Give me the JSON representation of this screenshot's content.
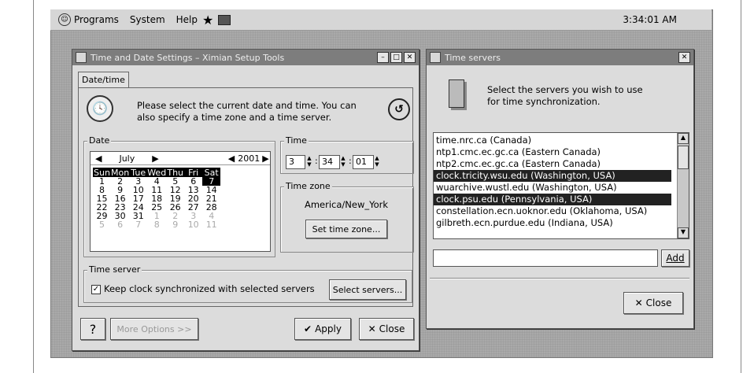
{
  "panel": {
    "programs": "Programs",
    "system": "System",
    "help": "Help",
    "clock": "3:34:01 AM"
  },
  "tdwin": {
    "title": "Time and Date Settings – Ximian Setup Tools",
    "tab": "Date/time",
    "intro": "Please select the current date and time. You can also specify a time zone and a time server.",
    "date_label": "Date",
    "month": "July",
    "year": "2001",
    "weekdays": [
      "Sun",
      "Mon",
      "Tue",
      "Wed",
      "Thu",
      "Fri",
      "Sat"
    ],
    "weeks": [
      [
        "1",
        "2",
        "3",
        "4",
        "5",
        "6",
        "7"
      ],
      [
        "8",
        "9",
        "10",
        "11",
        "12",
        "13",
        "14"
      ],
      [
        "15",
        "16",
        "17",
        "18",
        "19",
        "20",
        "21"
      ],
      [
        "22",
        "23",
        "24",
        "25",
        "26",
        "27",
        "28"
      ],
      [
        "29",
        "30",
        "31",
        "1",
        "2",
        "3",
        "4"
      ],
      [
        "5",
        "6",
        "7",
        "8",
        "9",
        "10",
        "11"
      ]
    ],
    "time_label": "Time",
    "hour": "3",
    "minute": "34",
    "second": "01",
    "tz_label": "Time zone",
    "tz_value": "America/New_York",
    "set_tz": "Set time zone...",
    "server_label": "Time server",
    "keep_sync": "Keep clock synchronized with selected servers",
    "select_servers": "Select servers...",
    "more": "More Options >>",
    "apply": "Apply",
    "close": "Close"
  },
  "tswin": {
    "title": "Time servers",
    "intro": "Select the servers you wish to use for time synchronization.",
    "servers": [
      "time.nrc.ca (Canada)",
      "ntp1.cmc.ec.gc.ca (Eastern Canada)",
      "ntp2.cmc.ec.gc.ca (Eastern Canada)",
      "clock.tricity.wsu.edu (Washington, USA)",
      "wuarchive.wustl.edu (Washington, USA)",
      "clock.psu.edu (Pennsylvania, USA)",
      "constellation.ecn.uoknor.edu (Oklahoma, USA)",
      "gilbreth.ecn.purdue.edu (Indiana, USA)"
    ],
    "add": "Add",
    "close": "Close"
  }
}
